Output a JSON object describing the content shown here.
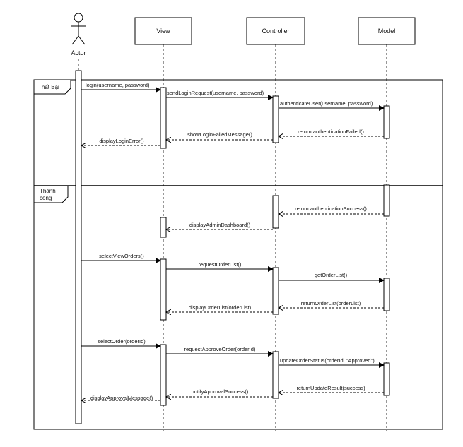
{
  "participants": {
    "actor": "Actor",
    "view": "View",
    "controller": "Controller",
    "model": "Model"
  },
  "fragments": {
    "failure": "Thất Bại",
    "success_line1": "Thành",
    "success_line2": "công"
  },
  "messages": {
    "m1": "login(username, password)",
    "m2": "sendLoginRequest(username, password)",
    "m3": "authenticateUser(username, password)",
    "m4": "return authenticationFailed()",
    "m5": "showLoginFailedMessage()",
    "m6": "displayLoginError()",
    "m7": "return authenticationSuccess()",
    "m8": "displayAdminDashboard()",
    "m9": "selectViewOrders()",
    "m10": "requestOrderList()",
    "m11": "getOrderList()",
    "m12": "returnOrderList(orderList)",
    "m13": "displayOrderList(orderList)",
    "m14": "selectOrder(orderId)",
    "m15": "requestApproveOrder(orderId)",
    "m16": "updateOrderStatus(orderId, \"Approved\")",
    "m17": "returnUpdateResult(success)",
    "m18": "notifyApprovalSuccess()",
    "m19": "displayApprovalMessage()"
  }
}
